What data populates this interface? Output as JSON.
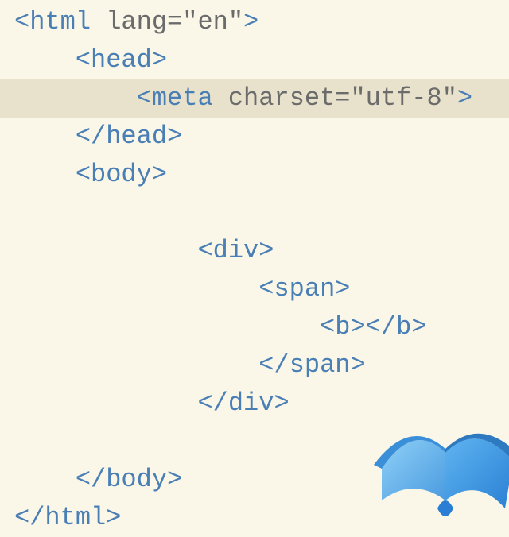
{
  "code": {
    "lines": [
      {
        "indent": 0,
        "highlighted": false,
        "tokens": [
          {
            "type": "angle",
            "text": "<"
          },
          {
            "type": "tag",
            "text": "html"
          },
          {
            "type": "attr",
            "text": " lang"
          },
          {
            "type": "eq",
            "text": "="
          },
          {
            "type": "str",
            "text": "\"en\""
          },
          {
            "type": "angle",
            "text": ">"
          }
        ]
      },
      {
        "indent": 1,
        "highlighted": false,
        "tokens": [
          {
            "type": "angle",
            "text": "<"
          },
          {
            "type": "tag",
            "text": "head"
          },
          {
            "type": "angle",
            "text": ">"
          }
        ]
      },
      {
        "indent": 2,
        "highlighted": true,
        "tokens": [
          {
            "type": "angle",
            "text": "<"
          },
          {
            "type": "tag",
            "text": "meta"
          },
          {
            "type": "attr",
            "text": " charset"
          },
          {
            "type": "eq",
            "text": "="
          },
          {
            "type": "str",
            "text": "\"utf-8\""
          },
          {
            "type": "angle",
            "text": ">"
          }
        ]
      },
      {
        "indent": 1,
        "highlighted": false,
        "tokens": [
          {
            "type": "angle",
            "text": "</"
          },
          {
            "type": "tag",
            "text": "head"
          },
          {
            "type": "angle",
            "text": ">"
          }
        ]
      },
      {
        "indent": 1,
        "highlighted": false,
        "tokens": [
          {
            "type": "angle",
            "text": "<"
          },
          {
            "type": "tag",
            "text": "body"
          },
          {
            "type": "angle",
            "text": ">"
          }
        ]
      },
      {
        "indent": 0,
        "highlighted": false,
        "tokens": []
      },
      {
        "indent": 3,
        "highlighted": false,
        "tokens": [
          {
            "type": "angle",
            "text": "<"
          },
          {
            "type": "tag",
            "text": "div"
          },
          {
            "type": "angle",
            "text": ">"
          }
        ]
      },
      {
        "indent": 4,
        "highlighted": false,
        "tokens": [
          {
            "type": "angle",
            "text": "<"
          },
          {
            "type": "tag",
            "text": "span"
          },
          {
            "type": "angle",
            "text": ">"
          }
        ]
      },
      {
        "indent": 5,
        "highlighted": false,
        "tokens": [
          {
            "type": "angle",
            "text": "<"
          },
          {
            "type": "tag",
            "text": "b"
          },
          {
            "type": "angle",
            "text": ">"
          },
          {
            "type": "angle",
            "text": "</"
          },
          {
            "type": "tag",
            "text": "b"
          },
          {
            "type": "angle",
            "text": ">"
          }
        ]
      },
      {
        "indent": 4,
        "highlighted": false,
        "tokens": [
          {
            "type": "angle",
            "text": "</"
          },
          {
            "type": "tag",
            "text": "span"
          },
          {
            "type": "angle",
            "text": ">"
          }
        ]
      },
      {
        "indent": 3,
        "highlighted": false,
        "tokens": [
          {
            "type": "angle",
            "text": "</"
          },
          {
            "type": "tag",
            "text": "div"
          },
          {
            "type": "angle",
            "text": ">"
          }
        ]
      },
      {
        "indent": 0,
        "highlighted": false,
        "tokens": []
      },
      {
        "indent": 1,
        "highlighted": false,
        "tokens": [
          {
            "type": "angle",
            "text": "</"
          },
          {
            "type": "tag",
            "text": "body"
          },
          {
            "type": "angle",
            "text": ">"
          }
        ]
      },
      {
        "indent": 0,
        "highlighted": false,
        "tokens": [
          {
            "type": "angle",
            "text": "</"
          },
          {
            "type": "tag",
            "text": "html"
          },
          {
            "type": "angle",
            "text": ">"
          }
        ]
      }
    ]
  },
  "indent_unit": "    "
}
